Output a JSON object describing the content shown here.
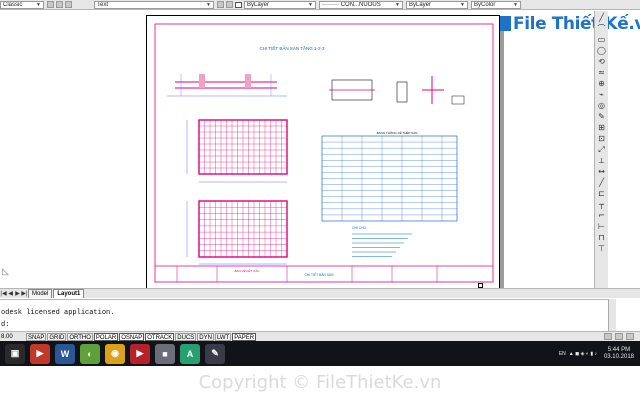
{
  "toolbar": {
    "workspace": "Classic",
    "text_style": "Text",
    "color": "ByLayer",
    "linetype": "CON...NUOUS",
    "lineweight": "ByLayer",
    "plot_style": "ByColor"
  },
  "logo": {
    "text": "File Thiết Kế.vn"
  },
  "drawing": {
    "title": "CHI TIẾT BẢN SÀN TẦNG 1-2-3",
    "table_title": "BẢNG THỐNG KÊ THÉP SÀN",
    "notes_heading": "GHI CHÚ:",
    "titleblock_label": "BẢN VẼ KẾT CẤU",
    "sheet_name": "CHI TIẾT BẢN SÀN"
  },
  "tabs": {
    "model": "Model",
    "layout": "Layout1"
  },
  "command": {
    "history": "odesk licensed application.",
    "prompt": "d:"
  },
  "status": {
    "coords": "8.00",
    "buttons": [
      {
        "label": "SNAP",
        "on": false
      },
      {
        "label": "GRID",
        "on": false
      },
      {
        "label": "ORTHO",
        "on": false
      },
      {
        "label": "POLAR",
        "on": true
      },
      {
        "label": "OSNAP",
        "on": true
      },
      {
        "label": "OTRACK",
        "on": true
      },
      {
        "label": "DUCS",
        "on": false
      },
      {
        "label": "DYN",
        "on": false
      },
      {
        "label": "LWT",
        "on": false
      },
      {
        "label": "PAPER",
        "on": true
      }
    ]
  },
  "taskbar": {
    "apps": [
      {
        "name": "task-view-icon",
        "label": "▣",
        "color": "#2a2a2a"
      },
      {
        "name": "media-player-icon",
        "label": "▶",
        "color": "#c0392b"
      },
      {
        "name": "word-icon",
        "label": "W",
        "color": "#2b5797"
      },
      {
        "name": "coccoc-icon",
        "label": "◐",
        "color": "#5fa03a"
      },
      {
        "name": "chrome-icon",
        "label": "◉",
        "color": "#d9a21b"
      },
      {
        "name": "media-icon",
        "label": "▶",
        "color": "#b8212b"
      },
      {
        "name": "disk-icon",
        "label": "■",
        "color": "#6d6d7a"
      },
      {
        "name": "autocad-icon",
        "label": "A",
        "color": "#25a070"
      },
      {
        "name": "paint-icon",
        "label": "✎",
        "color": "#3a3a48"
      }
    ],
    "language": "EN",
    "time": "5:44 PM",
    "date": "03.10.2018"
  },
  "watermark": "Copyright © FileThietKe.vn",
  "palette": [
    "╱",
    "⌒",
    "▭",
    "◯",
    "⟲",
    "≈",
    "⊕",
    "⌁",
    "◎",
    "✎",
    "⊞",
    "⊡",
    "⤢",
    "⟂",
    "↔",
    "╱",
    "⊏",
    "┬",
    "⌐",
    "⊢",
    "⊓",
    "⊤"
  ]
}
